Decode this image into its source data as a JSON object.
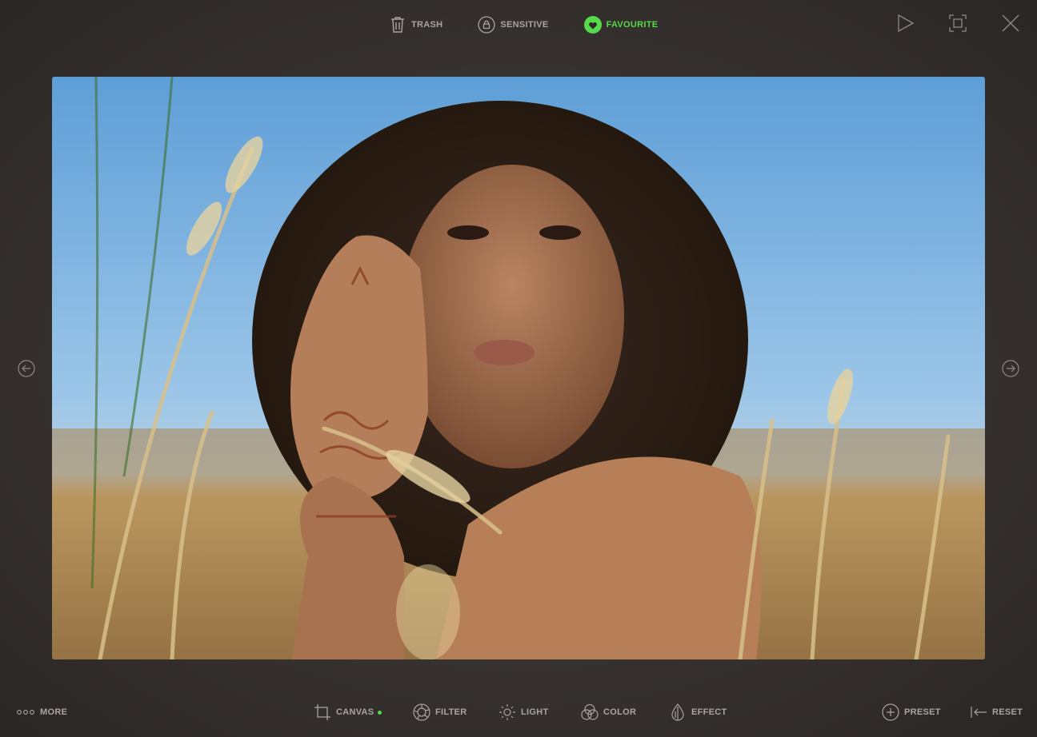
{
  "toolbar": {
    "trash_label": "TRASH",
    "sensitive_label": "SENSITIVE",
    "favourite_label": "FAVOURITE"
  },
  "bottom": {
    "more_label": "MORE",
    "canvas_label": "CANVAS",
    "filter_label": "FILTER",
    "light_label": "LIGHT",
    "color_label": "COLOR",
    "effect_label": "EFFECT",
    "preset_label": "PRESET",
    "reset_label": "RESET"
  },
  "colors": {
    "accent": "#56d94a",
    "icon": "#a9a4a0"
  },
  "icons": {
    "trash": "trash-icon",
    "sensitive": "lock-icon",
    "favourite": "heart-icon",
    "play": "play-icon",
    "fullscreen": "fullscreen-icon",
    "close": "close-icon",
    "prev": "arrow-left-icon",
    "next": "arrow-right-icon",
    "more": "more-icon",
    "canvas": "crop-icon",
    "filter": "aperture-icon",
    "light": "sun-icon",
    "color": "color-circles-icon",
    "effect": "drop-icon",
    "preset": "plus-circle-icon",
    "reset": "reset-icon"
  },
  "canvas_active": true
}
